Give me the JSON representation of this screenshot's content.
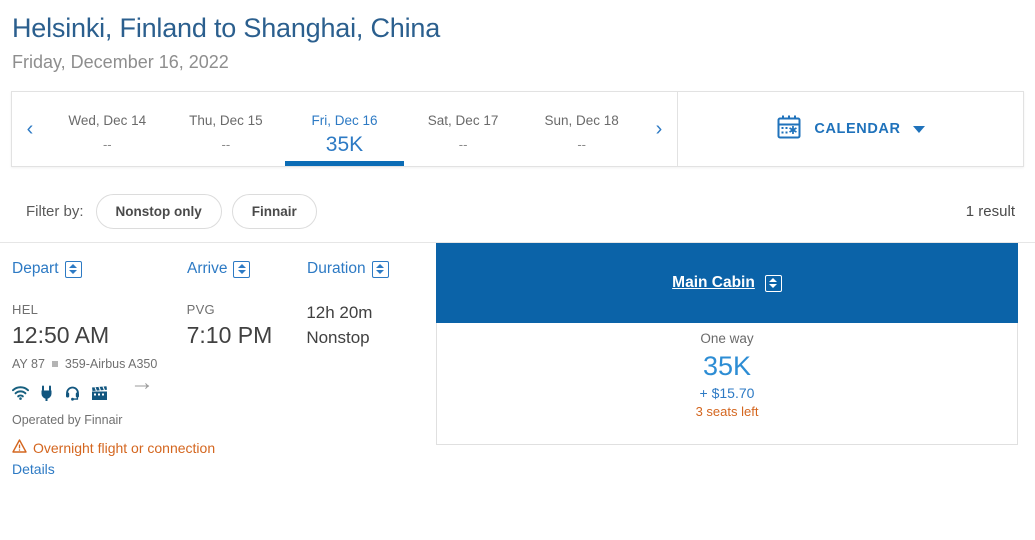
{
  "header": {
    "route_title": "Helsinki, Finland to Shanghai, China",
    "date_subtitle": "Friday, December 16, 2022"
  },
  "date_strip": {
    "prev_label": "‹",
    "next_label": "›",
    "days": [
      {
        "label": "Wed, Dec 14",
        "price": "--",
        "selected": false
      },
      {
        "label": "Thu, Dec 15",
        "price": "--",
        "selected": false
      },
      {
        "label": "Fri, Dec 16",
        "price": "35K",
        "selected": true
      },
      {
        "label": "Sat, Dec 17",
        "price": "--",
        "selected": false
      },
      {
        "label": "Sun, Dec 18",
        "price": "--",
        "selected": false
      }
    ],
    "calendar_label": "CALENDAR",
    "calendar_icon": "calendar-icon"
  },
  "filters": {
    "label": "Filter by:",
    "chips": [
      "Nonstop only",
      "Finnair"
    ],
    "result_count": "1 result"
  },
  "columns": {
    "depart": "Depart",
    "arrive": "Arrive",
    "duration": "Duration",
    "cabin": "Main Cabin"
  },
  "flight": {
    "origin_code": "HEL",
    "depart_time": "12:50 AM",
    "arrow": "→",
    "destination_code": "PVG",
    "arrive_time": "7:10 PM",
    "duration": "12h 20m",
    "stops": "Nonstop",
    "flight_number": "AY 87",
    "aircraft": "359-Airbus A350",
    "amenities": [
      "wifi-icon",
      "power-outlet-icon",
      "audio-icon",
      "movie-icon"
    ],
    "operated_by": "Operated by Finnair",
    "warning_icon": "warning-triangle-icon",
    "warning_text": "Overnight flight or connection",
    "details_label": "Details"
  },
  "fare": {
    "type_label": "One way",
    "miles": "35K",
    "taxes": "+ $15.70",
    "seats_left": "3 seats left"
  },
  "colors": {
    "title_blue": "#2b5f8e",
    "link_blue": "#2d7ac4",
    "cabin_bar_blue": "#0b63a8",
    "accent_orange": "#d4661f",
    "muted_gray": "#707070"
  }
}
